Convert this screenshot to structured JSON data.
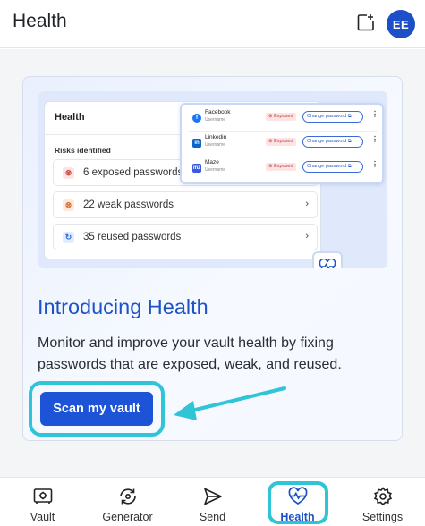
{
  "header": {
    "title": "Health",
    "avatar_initials": "EE"
  },
  "illustration": {
    "panel_title": "Health",
    "risks_heading": "Risks identified",
    "risks": [
      {
        "label": "6 exposed passwords",
        "icon": "x-icon"
      },
      {
        "label": "22 weak passwords",
        "icon": "x-icon"
      },
      {
        "label": "35 reused passwords",
        "icon": "refresh-icon"
      }
    ],
    "accounts": [
      {
        "name": "Facebook",
        "username": "Username",
        "badge": "Exposed",
        "action": "Change password",
        "logo": "f"
      },
      {
        "name": "Linkedin",
        "username": "Username",
        "badge": "Exposed",
        "action": "Change password",
        "logo": "in"
      },
      {
        "name": "Maze",
        "username": "Username",
        "badge": "Exposed",
        "action": "Change password",
        "logo": "mz"
      }
    ]
  },
  "intro": {
    "title": "Introducing Health",
    "body": "Monitor and improve your vault health by fixing passwords that are exposed, weak, and reused.",
    "scan_button": "Scan my vault"
  },
  "tabs": [
    {
      "label": "Vault",
      "icon": "vault-icon",
      "active": false
    },
    {
      "label": "Generator",
      "icon": "generator-icon",
      "active": false
    },
    {
      "label": "Send",
      "icon": "send-icon",
      "active": false
    },
    {
      "label": "Health",
      "icon": "health-icon",
      "active": true
    },
    {
      "label": "Settings",
      "icon": "settings-icon",
      "active": false
    }
  ],
  "colors": {
    "accent": "#1d53c7",
    "highlight": "#2fc4d6"
  }
}
